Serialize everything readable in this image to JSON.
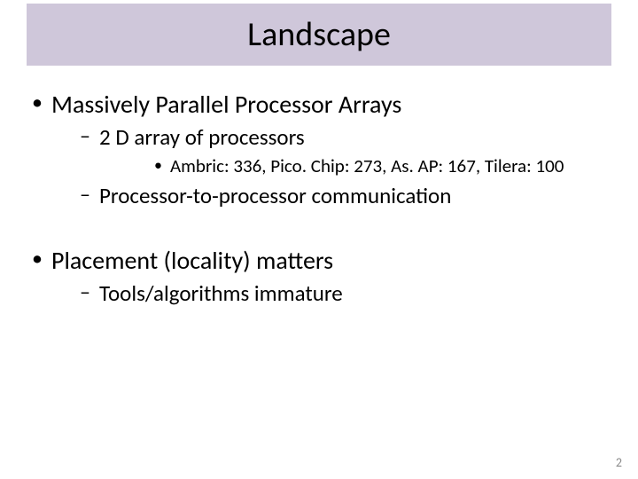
{
  "title": "Landscape",
  "bullets": {
    "b1": "Massively Parallel Processor Arrays",
    "b1_1": "2 D array of processors",
    "b1_1_1": "Ambric: 336, Pico. Chip: 273, As. AP: 167, Tilera: 100",
    "b1_2": "Processor-to-processor communication",
    "b2": "Placement (locality) matters",
    "b2_1": "Tools/algorithms immature"
  },
  "page_number": "2"
}
